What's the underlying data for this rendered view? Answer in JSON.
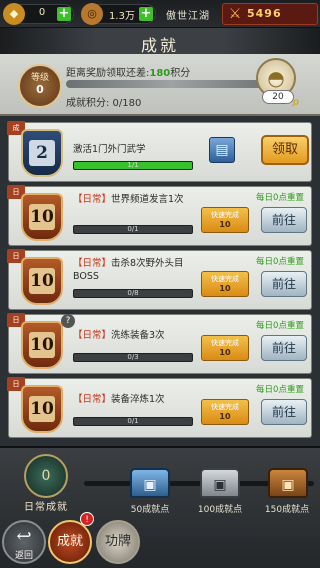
{
  "topbar": {
    "resource1": {
      "value": "0",
      "icon": "coin-stack-icon"
    },
    "resource2": {
      "value": "1.3万",
      "icon": "copper-coin-icon"
    },
    "realm_name": "傲世江湖",
    "power": {
      "value": "5496",
      "icon": "crossed-swords-icon"
    }
  },
  "title": "成就",
  "summary": {
    "level_label": "等级",
    "level_value": "0",
    "next_reward_prefix": "距离奖励领取还差:",
    "next_reward_points": "180",
    "next_reward_suffix": "积分",
    "score_line": "成就积分: 0/180",
    "bowl_count": "20"
  },
  "tasks": [
    {
      "level": "2",
      "title": "激活1门外门武学",
      "tag": "",
      "progress_text": "1/1",
      "progress": 1.0,
      "action": "领取",
      "type": "claim",
      "icon_style": "blue"
    },
    {
      "level": "10",
      "tag": "【日常】",
      "title": "世界频道发言1次",
      "progress_text": "0/1",
      "progress": 0.0,
      "quick_label": "快速完成",
      "quick_cost": "10",
      "reset": "每日0点重置",
      "action": "前往"
    },
    {
      "level": "10",
      "tag": "【日常】",
      "title": "击杀8次野外头目BOSS",
      "progress_text": "0/8",
      "progress": 0.0,
      "quick_label": "快速完成",
      "quick_cost": "10",
      "reset": "每日0点重置",
      "action": "前往"
    },
    {
      "level": "10",
      "tag": "【日常】",
      "title": "洗练装备3次",
      "progress_text": "0/3",
      "progress": 0.0,
      "quick_label": "快速完成",
      "quick_cost": "10",
      "reset": "每日0点重置",
      "action": "前往"
    },
    {
      "level": "10",
      "tag": "【日常】",
      "title": "装备淬炼1次",
      "progress_text": "0/1",
      "progress": 0.0,
      "quick_label": "快速完成",
      "quick_cost": "10",
      "reset": "每日0点重置",
      "action": "前往"
    }
  ],
  "daily": {
    "label": "日常成就",
    "emblem_value": "0",
    "chests": [
      {
        "label": "50成就点"
      },
      {
        "label": "100成就点"
      },
      {
        "label": "150成就点"
      }
    ]
  },
  "nav": {
    "back": "返回",
    "achievements": "成就",
    "achievements_badge": "!",
    "merit": "功牌"
  },
  "colors": {
    "accent_green": "#2f9b1c",
    "daily_tag_red": "#c9361c",
    "power_gold": "#ffcf6a"
  }
}
